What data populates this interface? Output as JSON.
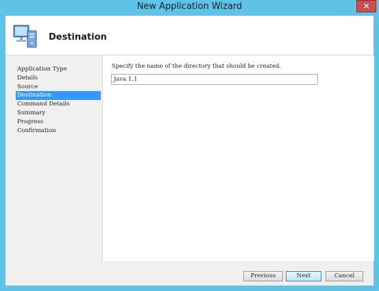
{
  "window": {
    "title": "New Application Wizard",
    "close_glyph": "✕"
  },
  "header": {
    "title": "Destination",
    "icon": "computer-icon"
  },
  "steps": [
    {
      "label": "Application Type",
      "active": false
    },
    {
      "label": "Details",
      "active": false
    },
    {
      "label": "Source",
      "active": false
    },
    {
      "label": "Destination",
      "active": true
    },
    {
      "label": "Command Details",
      "active": false
    },
    {
      "label": "Summary",
      "active": false
    },
    {
      "label": "Progress",
      "active": false
    },
    {
      "label": "Confirmation",
      "active": false
    }
  ],
  "content": {
    "prompt": "Specify the name of the directory that should be created.",
    "directory_value": "Java 1.1"
  },
  "buttons": {
    "previous": "Previous",
    "next": "Next",
    "cancel": "Cancel"
  },
  "colors": {
    "title_bar": "#5fc3e8",
    "selection": "#3399ff",
    "close_button": "#c75050"
  }
}
